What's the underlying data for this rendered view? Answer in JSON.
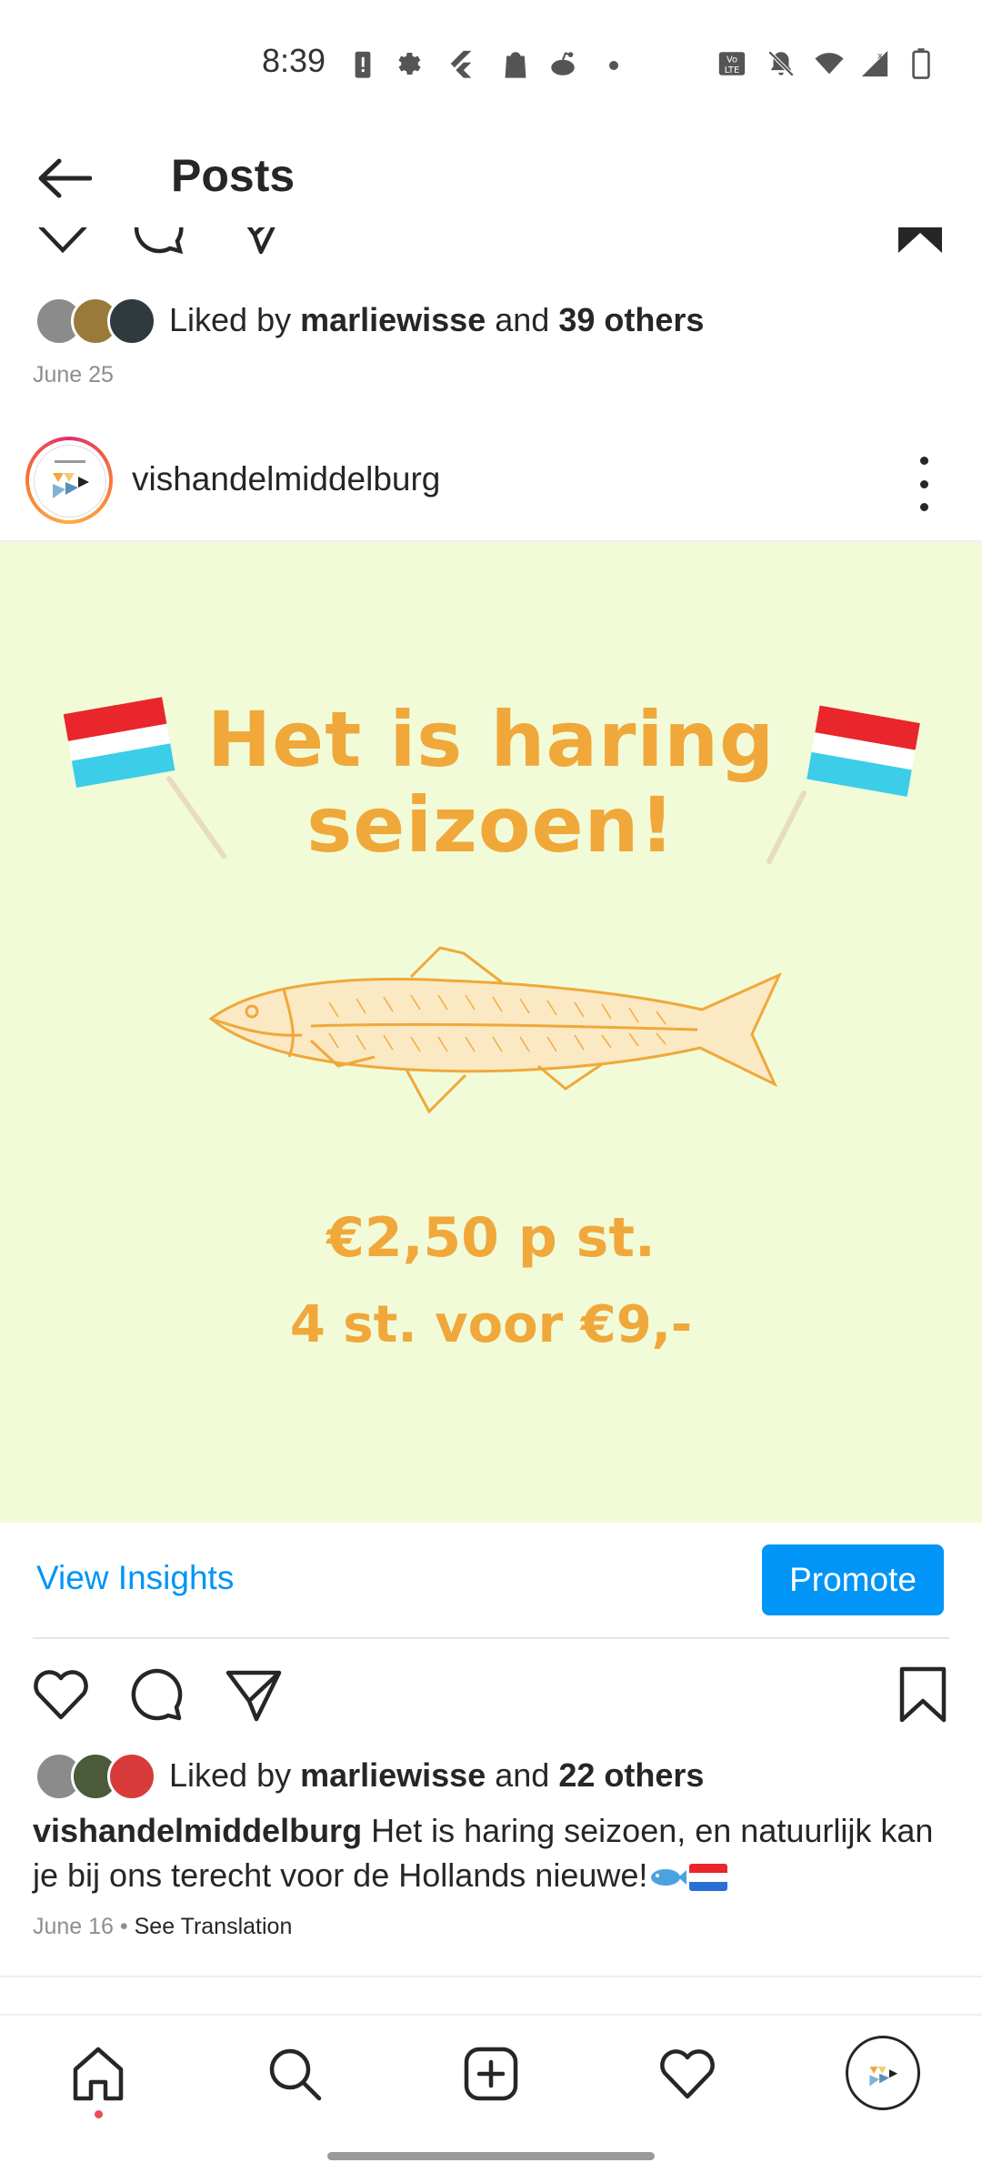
{
  "status_bar": {
    "time": "8:39"
  },
  "header": {
    "title": "Posts"
  },
  "previous_post": {
    "liked_by_prefix": "Liked by ",
    "liked_by_user": "marliewisse",
    "liked_by_and": " and ",
    "liked_by_others": "39 others",
    "date": "June 25"
  },
  "post": {
    "username": "vishandelmiddelburg",
    "image": {
      "title_line1": "Het is haring",
      "title_line2": "seizoen!",
      "price_line1": "€2,50 p st.",
      "price_line2": "4 st. voor €9,-"
    },
    "view_insights_label": "View Insights",
    "promote_label": "Promote",
    "liked_by_prefix": "Liked by ",
    "liked_by_user": "marliewisse",
    "liked_by_and": " and ",
    "liked_by_others": "22 others",
    "caption_user": "vishandelmiddelburg",
    "caption_text": " Het is haring seizoen, en natuurlijk kan je bij ons terecht voor de Hollands nieuwe!",
    "date": "June 16",
    "separator": " • ",
    "see_translation": "See Translation"
  },
  "nav": {
    "items": [
      "home-icon",
      "search-icon",
      "create-icon",
      "activity-icon",
      "profile-avatar"
    ]
  },
  "colors": {
    "accent": "#0095f6",
    "post_bg": "#f1fbd8",
    "image_text": "#f0a83a",
    "notification_dot": "#ed4956"
  }
}
